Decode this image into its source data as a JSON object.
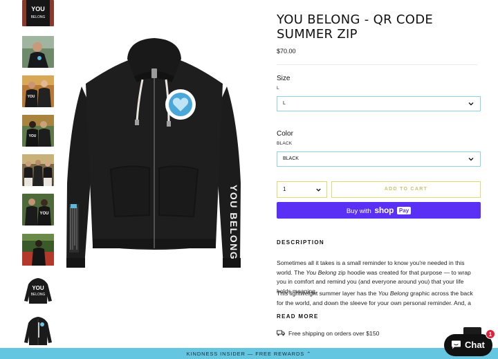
{
  "product": {
    "title": "YOU BELONG - QR CODE SUMMER ZIP",
    "price": "$70.00",
    "size": {
      "label": "Size",
      "current": "L",
      "selected": "L"
    },
    "color": {
      "label": "Color",
      "current": "BLACK",
      "selected": "BLACK"
    },
    "quantity": "1",
    "add_to_cart": "ADD TO CART",
    "shop_pay": {
      "prefix": "Buy with",
      "brand": "shop",
      "badge": "Pay"
    }
  },
  "description": {
    "heading": "DESCRIPTION",
    "p1_a": "Sometimes all it takes is a small reminder to know you're needed in this world. The ",
    "p1_em": "You Belong",
    "p1_b": " zip hoodie was created for that purpose — to wrap you in comfort and remind you (and everyone around you) that your life holds meaning.",
    "p2_a": "This lightweight summer layer has the ",
    "p2_em": "You Belong",
    "p2_b": " graphic across the back for the world, and down the sleeve for your own personal reminder. And, a",
    "read_more": "READ MORE"
  },
  "shipping": "Free shipping on orders over $150",
  "bottom_bar": "KINDNESS INSIDER — FREE REWARDS ⌃",
  "chat": {
    "label": "Chat",
    "badge": "1"
  },
  "sleeve_text": "YOU BELONG",
  "thumb_text": {
    "you": "YOU",
    "belong": "BELONG"
  },
  "colors": {
    "accent_blue": "#64c6e0",
    "select_border": "#8fd3dc",
    "cart_border": "#e4d96f",
    "shop_pay": "#5a31f4",
    "hoodie": "#1c1c1c"
  },
  "icons": [
    "chevron-down-icon",
    "truck-icon",
    "chat-bubble-icon"
  ]
}
